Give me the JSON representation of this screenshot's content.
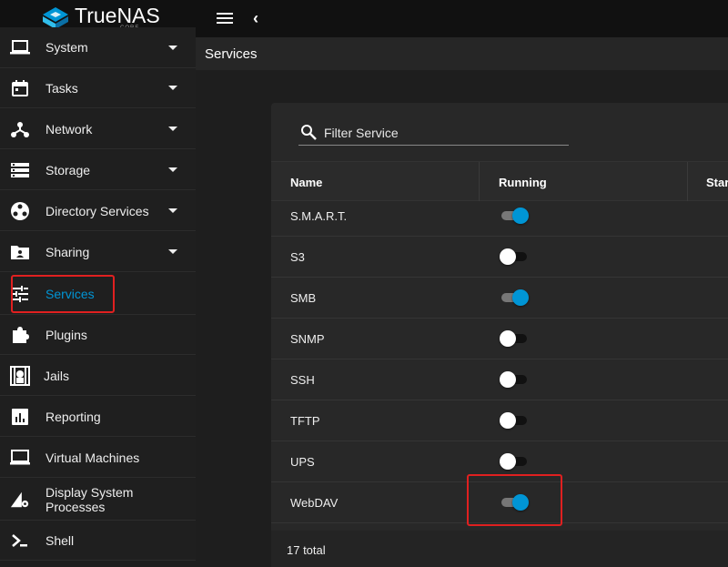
{
  "app": {
    "brand_name": "TrueNAS",
    "brand_sub": "CORE",
    "accent_color": "#0095d5",
    "highlight_color": "#e02020"
  },
  "topbar": {
    "menu_icon": "hamburger-icon",
    "back_icon": "chevron-left-icon"
  },
  "sidebar": {
    "items": [
      {
        "label": "System",
        "icon": "laptop-icon",
        "expandable": true
      },
      {
        "label": "Tasks",
        "icon": "calendar-icon",
        "expandable": true
      },
      {
        "label": "Network",
        "icon": "network-icon",
        "expandable": true
      },
      {
        "label": "Storage",
        "icon": "storage-icon",
        "expandable": true
      },
      {
        "label": "Directory Services",
        "icon": "directory-icon",
        "expandable": true
      },
      {
        "label": "Sharing",
        "icon": "folder-share-icon",
        "expandable": true
      },
      {
        "label": "Services",
        "icon": "tune-icon",
        "expandable": false,
        "active": true
      },
      {
        "label": "Plugins",
        "icon": "puzzle-icon",
        "expandable": false
      },
      {
        "label": "Jails",
        "icon": "jail-icon",
        "expandable": false
      },
      {
        "label": "Reporting",
        "icon": "chart-icon",
        "expandable": false
      },
      {
        "label": "Virtual Machines",
        "icon": "computer-icon",
        "expandable": false
      },
      {
        "label": "Display System Processes",
        "icon": "processes-icon",
        "expandable": false
      },
      {
        "label": "Shell",
        "icon": "console-icon",
        "expandable": false
      }
    ]
  },
  "page": {
    "title": "Services"
  },
  "filter": {
    "placeholder": "Filter Service"
  },
  "table": {
    "columns": [
      "Name",
      "Running",
      "Star"
    ],
    "rows": [
      {
        "name": "S.M.A.R.T.",
        "running": true
      },
      {
        "name": "S3",
        "running": false
      },
      {
        "name": "SMB",
        "running": true
      },
      {
        "name": "SNMP",
        "running": false
      },
      {
        "name": "SSH",
        "running": false
      },
      {
        "name": "TFTP",
        "running": false
      },
      {
        "name": "UPS",
        "running": false
      },
      {
        "name": "WebDAV",
        "running": true
      }
    ],
    "total": "17 total"
  }
}
